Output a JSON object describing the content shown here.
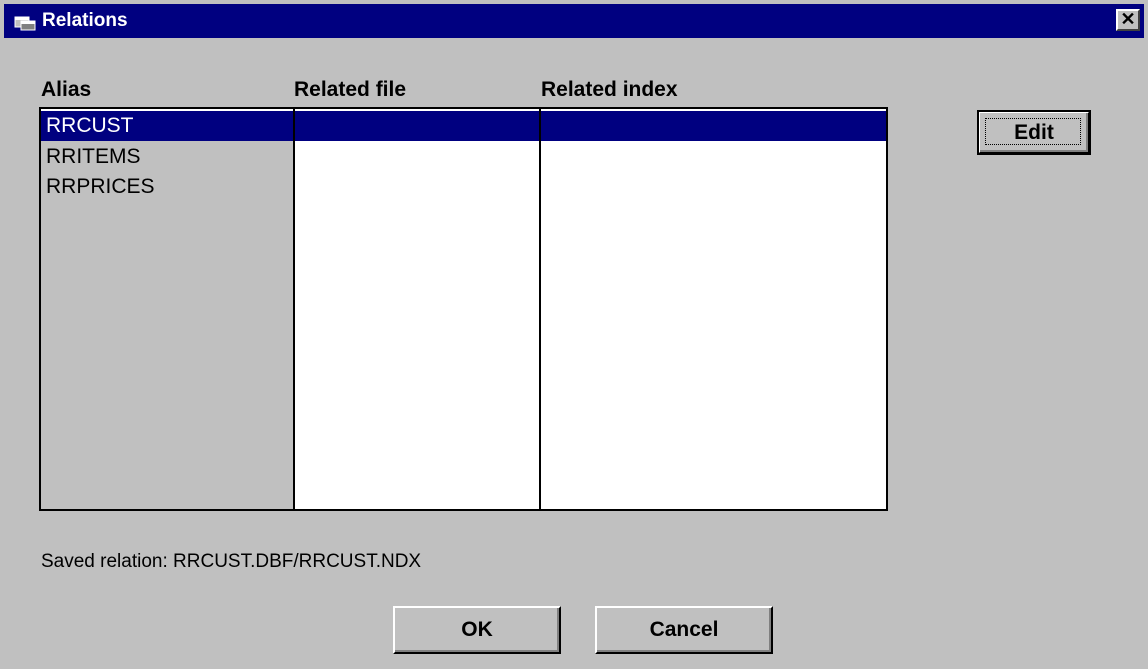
{
  "window": {
    "title": "Relations",
    "close_glyph": "✕",
    "icon": "window-app-icon"
  },
  "columns": {
    "alias": "Alias",
    "related_file": "Related file",
    "related_index": "Related index"
  },
  "rows": [
    {
      "alias": "RRCUST",
      "related_file": "",
      "related_index": "",
      "selected": true
    },
    {
      "alias": "RRITEMS",
      "related_file": "",
      "related_index": "",
      "selected": false
    },
    {
      "alias": "RRPRICES",
      "related_file": "",
      "related_index": "",
      "selected": false
    }
  ],
  "buttons": {
    "edit": "Edit",
    "ok": "OK",
    "cancel": "Cancel"
  },
  "status": {
    "saved_relation": "Saved relation: RRCUST.DBF/RRCUST.NDX"
  },
  "colors": {
    "titlebar": "#000080",
    "face": "#c0c0c0",
    "selection": "#000080"
  }
}
